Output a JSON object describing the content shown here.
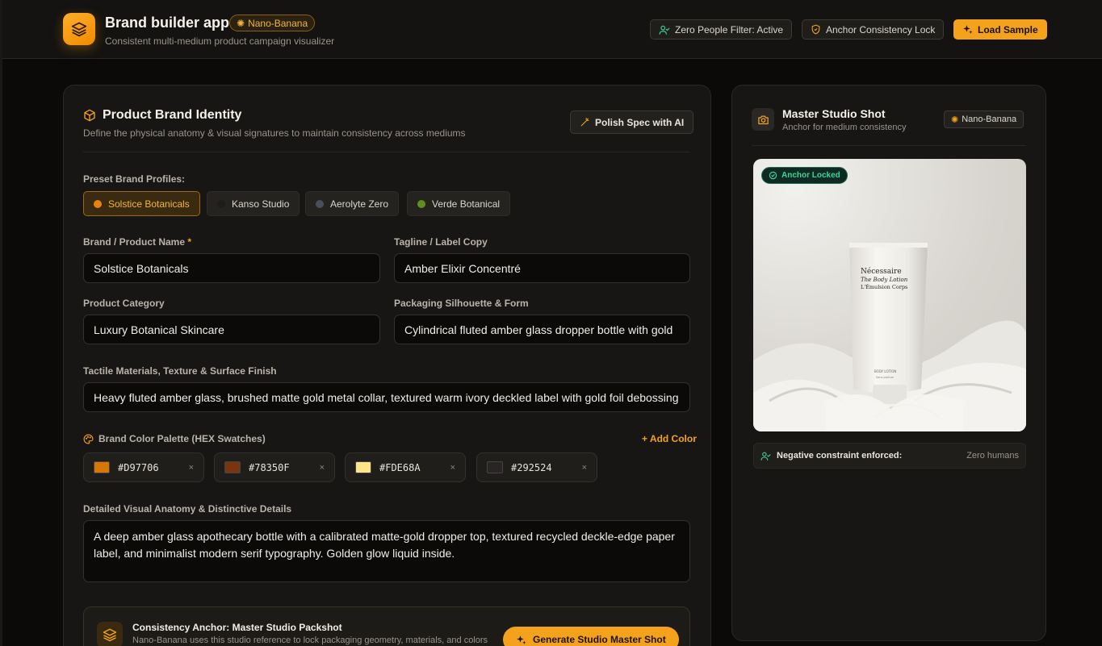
{
  "header": {
    "title": "Brand builder app",
    "badge": "Nano-Banana",
    "subtitle": "Consistent multi-medium product campaign visualizer",
    "filter_label": "Zero People Filter: Active",
    "lock_label": "Anchor Consistency Lock",
    "sample_label": "Load Sample"
  },
  "identity": {
    "title": "Product Brand Identity",
    "subtitle": "Define the physical anatomy & visual signatures to maintain consistency across mediums",
    "polish_label": "Polish Spec with AI",
    "presets_label": "Preset Brand Profiles:",
    "presets": [
      {
        "label": "Solstice Botanicals",
        "color": "#E8820F"
      },
      {
        "label": "Kanso Studio",
        "color": "#1E1D1B"
      },
      {
        "label": "Aerolyte Zero",
        "color": "#4B4E5A"
      },
      {
        "label": "Verde Botanical",
        "color": "#5E8F1F"
      }
    ],
    "fields": {
      "brand_label": "Brand / Product Name",
      "brand_required": "*",
      "brand_value": "Solstice Botanicals",
      "tagline_label": "Tagline / Label Copy",
      "tagline_value": "Amber Elixir Concentré",
      "category_label": "Product Category",
      "category_value": "Luxury Botanical Skincare",
      "packaging_label": "Packaging Silhouette & Form",
      "packaging_value": "Cylindrical fluted amber glass dropper bottle with gold",
      "materials_label": "Tactile Materials, Texture & Surface Finish",
      "materials_value": "Heavy fluted amber glass, brushed matte gold metal collar, textured warm ivory deckled label with gold foil debossing"
    },
    "palette_label": "Brand Color Palette (HEX Swatches)",
    "add_color_label": "+ Add Color",
    "palette": [
      {
        "hex": "#D97706"
      },
      {
        "hex": "#78350F"
      },
      {
        "hex": "#FDE68A"
      },
      {
        "hex": "#292524"
      }
    ],
    "remove_glyph": "×",
    "anatomy_label": "Detailed Visual Anatomy & Distinctive Details",
    "anatomy_value": "A deep amber glass apothecary bottle with a calibrated matte-gold dropper top, textured recycled deckle-edge paper label, and minimalist modern serif typography. Golden glow liquid inside.",
    "anchor": {
      "title": "Consistency Anchor: Master Studio Packshot",
      "subtitle": "Nano-Banana uses this studio reference to lock packaging geometry, materials, and colors",
      "button_label": "Generate Studio Master Shot"
    }
  },
  "master": {
    "title": "Master Studio Shot",
    "subtitle": "Anchor for medium consistency",
    "badge": "Nano-Banana",
    "locked_label": "Anchor Locked",
    "tube": {
      "line1": "Nécessaire",
      "line2": "The Body Lotion",
      "line3": "L'Émulsion Corps",
      "small1": "BODY LOTION",
      "small2": "Sans parfum"
    },
    "constraint_key": "Negative constraint enforced:",
    "constraint_value": "Zero humans"
  },
  "colors": {
    "accent": "#F4A21B",
    "success": "#3FD39A"
  }
}
